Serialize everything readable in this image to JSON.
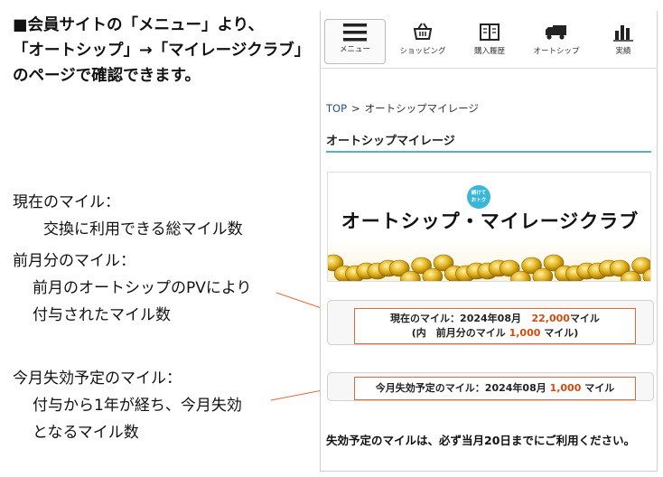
{
  "intro": {
    "line1": "■会員サイトの「メニュー」より、",
    "line2": "「オートシップ」→「マイレージクラブ」",
    "line3": "のページで確認できます。"
  },
  "explanations": {
    "current": {
      "title": "現在のマイル：",
      "desc": "交換に利用できる総マイル数"
    },
    "prev": {
      "title": "前月分のマイル：",
      "desc1": "前月のオートシップのPVにより",
      "desc2": "付与されたマイル数"
    },
    "expire": {
      "title": "今月失効予定のマイル：",
      "desc1": "付与から1年が経ち、今月失効",
      "desc2": "となるマイル数"
    }
  },
  "nav": {
    "menu": "メニュー",
    "shopping": "ショッピング",
    "history": "購入履歴",
    "autoship": "オートシップ",
    "results": "実績",
    "icons": [
      "hamburger-icon",
      "basket-icon",
      "book-icon",
      "truck-icon",
      "bar-chart-icon"
    ]
  },
  "breadcrumb": {
    "top": "TOP",
    "sep": ">",
    "current": "オートシップマイレージ"
  },
  "page_title": "オートシップマイレージ",
  "banner": {
    "badge_line1": "続けて",
    "badge_line2": "おトク",
    "title": "オートシップ・マイレージクラブ"
  },
  "current_miles": {
    "label": "現在のマイル：2024年08月",
    "value": "22,000",
    "unit": "マイル",
    "prev_prefix": "(内　前月分のマイル",
    "prev_value": "1,000",
    "prev_unit": "マイル)"
  },
  "expire_miles": {
    "label": "今月失効予定のマイル：2024年08月",
    "value": "1,000",
    "unit": "マイル"
  },
  "notice": "失効予定のマイルは、必ず当月20日までにご利用ください。",
  "colors": {
    "accent_teal": "#5ab3b8",
    "highlight_orange": "#e06b3a",
    "number_red": "#d24a10",
    "badge_blue": "#39b7d8"
  }
}
